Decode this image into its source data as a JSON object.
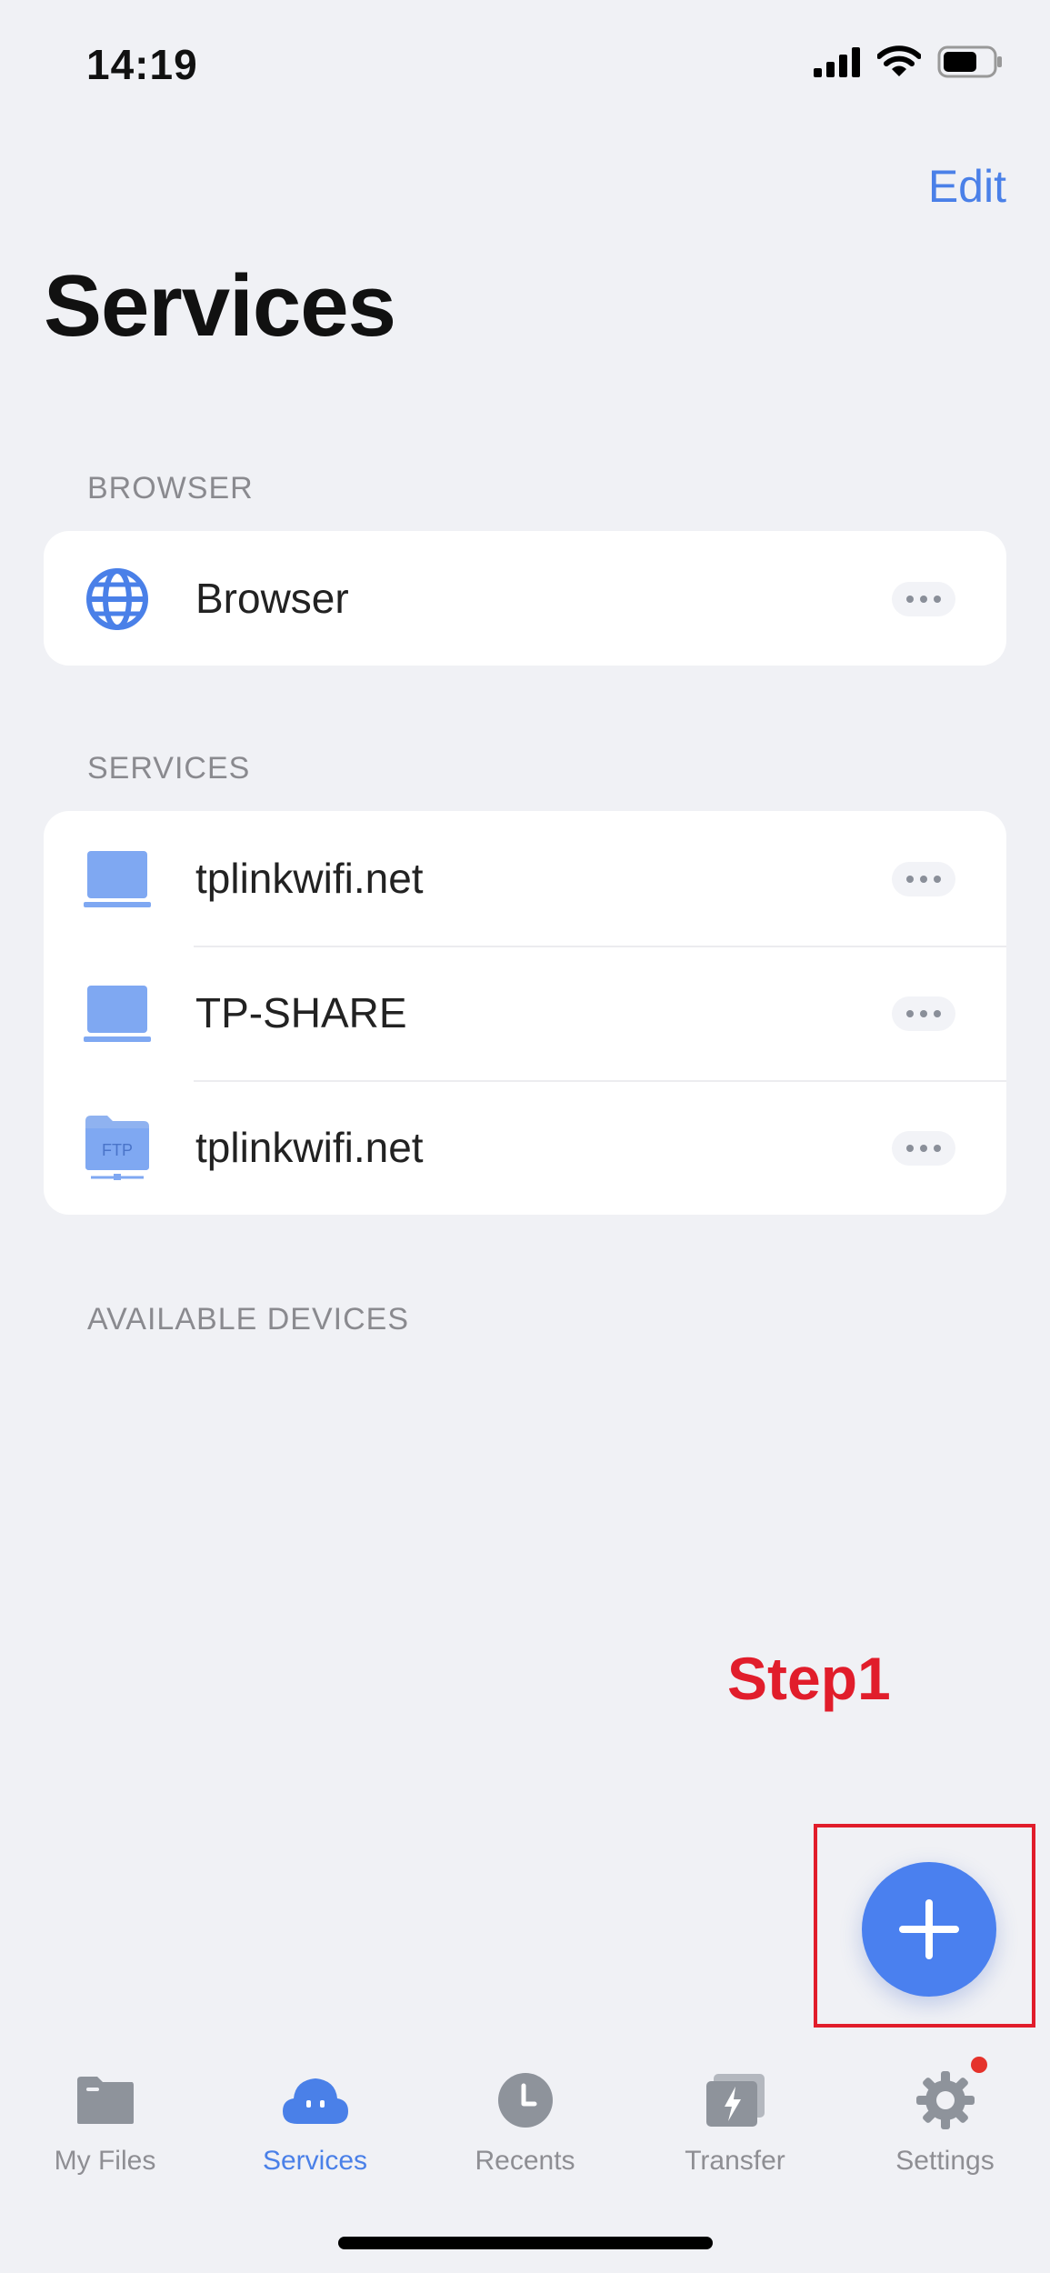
{
  "status_bar": {
    "time": "14:19"
  },
  "header": {
    "edit_label": "Edit",
    "title": "Services"
  },
  "browser_section": {
    "header": "BROWSER",
    "items": [
      {
        "label": "Browser",
        "icon": "globe-icon"
      }
    ]
  },
  "services_section": {
    "header": "SERVICES",
    "items": [
      {
        "label": "tplinkwifi.net",
        "icon": "laptop-icon"
      },
      {
        "label": "TP-SHARE",
        "icon": "laptop-icon"
      },
      {
        "label": "tplinkwifi.net",
        "icon": "ftp-folder-icon",
        "icon_text": "FTP"
      }
    ]
  },
  "devices_section": {
    "header": "AVAILABLE DEVICES"
  },
  "annotation": {
    "step_label": "Step1"
  },
  "fab": {
    "icon": "plus-icon"
  },
  "tab_bar": {
    "tabs": [
      {
        "label": "My Files",
        "icon": "folder-icon",
        "active": false
      },
      {
        "label": "Services",
        "icon": "cloud-icon",
        "active": true
      },
      {
        "label": "Recents",
        "icon": "clock-icon",
        "active": false
      },
      {
        "label": "Transfer",
        "icon": "transfer-icon",
        "active": false
      },
      {
        "label": "Settings",
        "icon": "gear-icon",
        "active": false,
        "badge": true
      }
    ]
  },
  "colors": {
    "accent": "#4a80e8",
    "background": "#f0f1f5",
    "annotation": "#e11d2b",
    "badge": "#e5322b"
  }
}
